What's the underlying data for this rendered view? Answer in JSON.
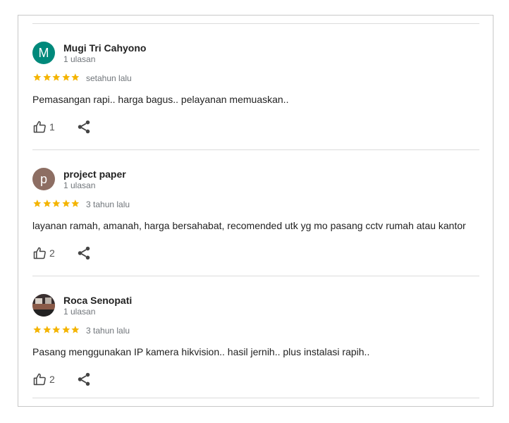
{
  "colors": {
    "star": "#f4b400",
    "avatar_m": "#00897b",
    "avatar_p": "#8d6e63",
    "divider": "#dcdcdc",
    "meta_text": "#70757a"
  },
  "reviews": [
    {
      "avatar_letter": "M",
      "name": "Mugi Tri Cahyono",
      "review_count": "1 ulasan",
      "rating": 5,
      "time": "setahun lalu",
      "text": "Pemasangan rapi.. harga bagus.. pelayanan memuaskan..",
      "likes": "1"
    },
    {
      "avatar_letter": "p",
      "name": "project paper",
      "review_count": "1 ulasan",
      "rating": 5,
      "time": "3 tahun lalu",
      "text": "layanan ramah, amanah, harga bersahabat, recomended utk yg mo pasang cctv rumah atau kantor",
      "likes": "2"
    },
    {
      "avatar_letter": "",
      "name": "Roca Senopati",
      "review_count": "1 ulasan",
      "rating": 5,
      "time": "3 tahun lalu",
      "text": "Pasang menggunakan IP kamera hikvision.. hasil jernih.. plus instalasi rapih..",
      "likes": "2"
    }
  ],
  "icons": {
    "like": "thumbs-up-icon",
    "share": "share-icon",
    "star": "star-icon"
  }
}
